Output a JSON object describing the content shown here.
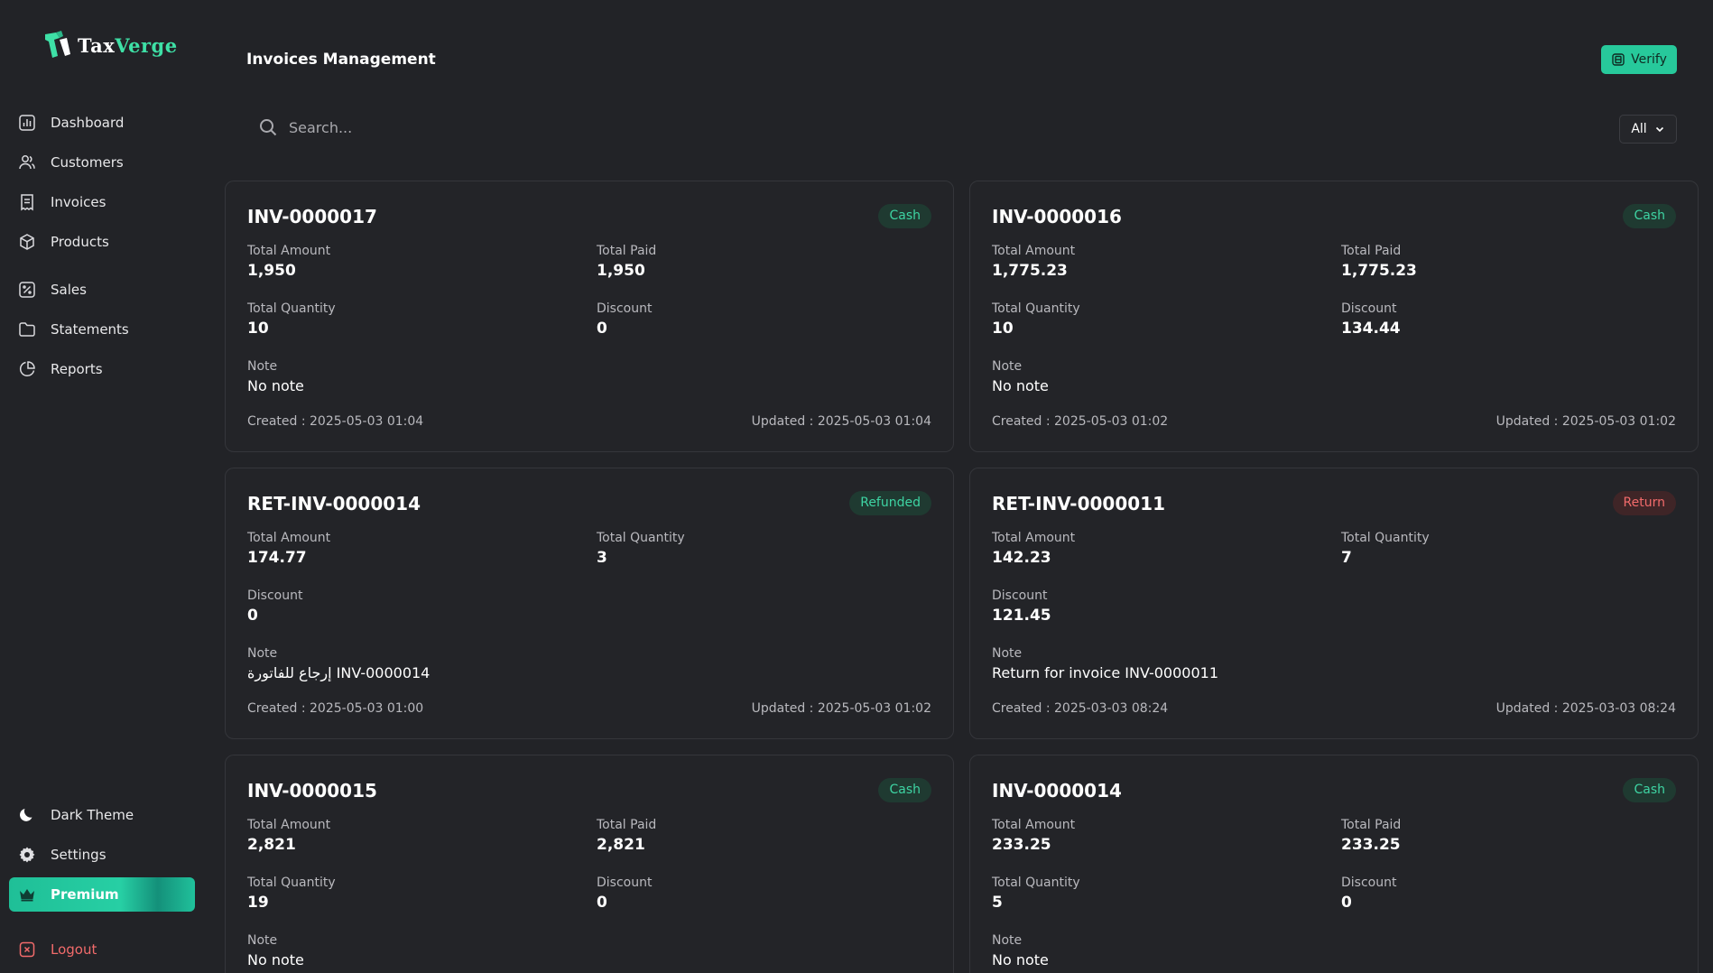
{
  "brand": {
    "logo_part1": "Tax",
    "logo_part2": "Verge",
    "accent": "#3ee0a6"
  },
  "header": {
    "title": "Invoices Management",
    "verify_label": "Verify"
  },
  "search": {
    "placeholder": "Search..."
  },
  "filter": {
    "selected": "All"
  },
  "sidebar": {
    "items": [
      {
        "label": "Dashboard",
        "icon": "chart-icon"
      },
      {
        "label": "Customers",
        "icon": "users-icon"
      },
      {
        "label": "Invoices",
        "icon": "receipt-icon"
      },
      {
        "label": "Products",
        "icon": "box-icon"
      },
      {
        "label": "Sales",
        "icon": "sales-icon"
      },
      {
        "label": "Statements",
        "icon": "folder-icon"
      },
      {
        "label": "Reports",
        "icon": "pie-icon"
      }
    ],
    "bottom": {
      "theme": "Dark Theme",
      "settings": "Settings",
      "premium": "Premium",
      "logout": "Logout"
    }
  },
  "labels": {
    "total_amount": "Total Amount",
    "total_paid": "Total Paid",
    "total_quantity": "Total Quantity",
    "discount": "Discount",
    "note": "Note"
  },
  "invoices": [
    {
      "id": "INV-0000017",
      "badge": "Cash",
      "total_amount": "1,950",
      "total_paid": "1,950",
      "total_quantity": "10",
      "discount": "0",
      "note": "No note",
      "created": "Created : 2025-05-03 01:04",
      "updated": "Updated : 2025-05-03 01:04"
    },
    {
      "id": "INV-0000016",
      "badge": "Cash",
      "total_amount": "1,775.23",
      "total_paid": "1,775.23",
      "total_quantity": "10",
      "discount": "134.44",
      "note": "No note",
      "created": "Created : 2025-05-03 01:02",
      "updated": "Updated : 2025-05-03 01:02"
    },
    {
      "id": "RET-INV-0000014",
      "badge": "Refunded",
      "total_amount": "174.77",
      "total_quantity": "3",
      "discount": "0",
      "note": "إرجاع للفاتورة INV-0000014",
      "created": "Created : 2025-05-03 01:00",
      "updated": "Updated : 2025-05-03 01:02"
    },
    {
      "id": "RET-INV-0000011",
      "badge": "Return",
      "total_amount": "142.23",
      "total_quantity": "7",
      "discount": "121.45",
      "note": "Return for invoice INV-0000011",
      "created": "Created : 2025-03-03 08:24",
      "updated": "Updated : 2025-03-03 08:24"
    },
    {
      "id": "INV-0000015",
      "badge": "Cash",
      "total_amount": "2,821",
      "total_paid": "2,821",
      "total_quantity": "19",
      "discount": "0",
      "note": "No note"
    },
    {
      "id": "INV-0000014",
      "badge": "Cash",
      "total_amount": "233.25",
      "total_paid": "233.25",
      "total_quantity": "5",
      "discount": "0",
      "note": "No note"
    }
  ],
  "colors": {
    "background": "#222327",
    "success": "#3ed4a3",
    "danger": "#f26b6b",
    "verify_bg": "#27c99b"
  }
}
